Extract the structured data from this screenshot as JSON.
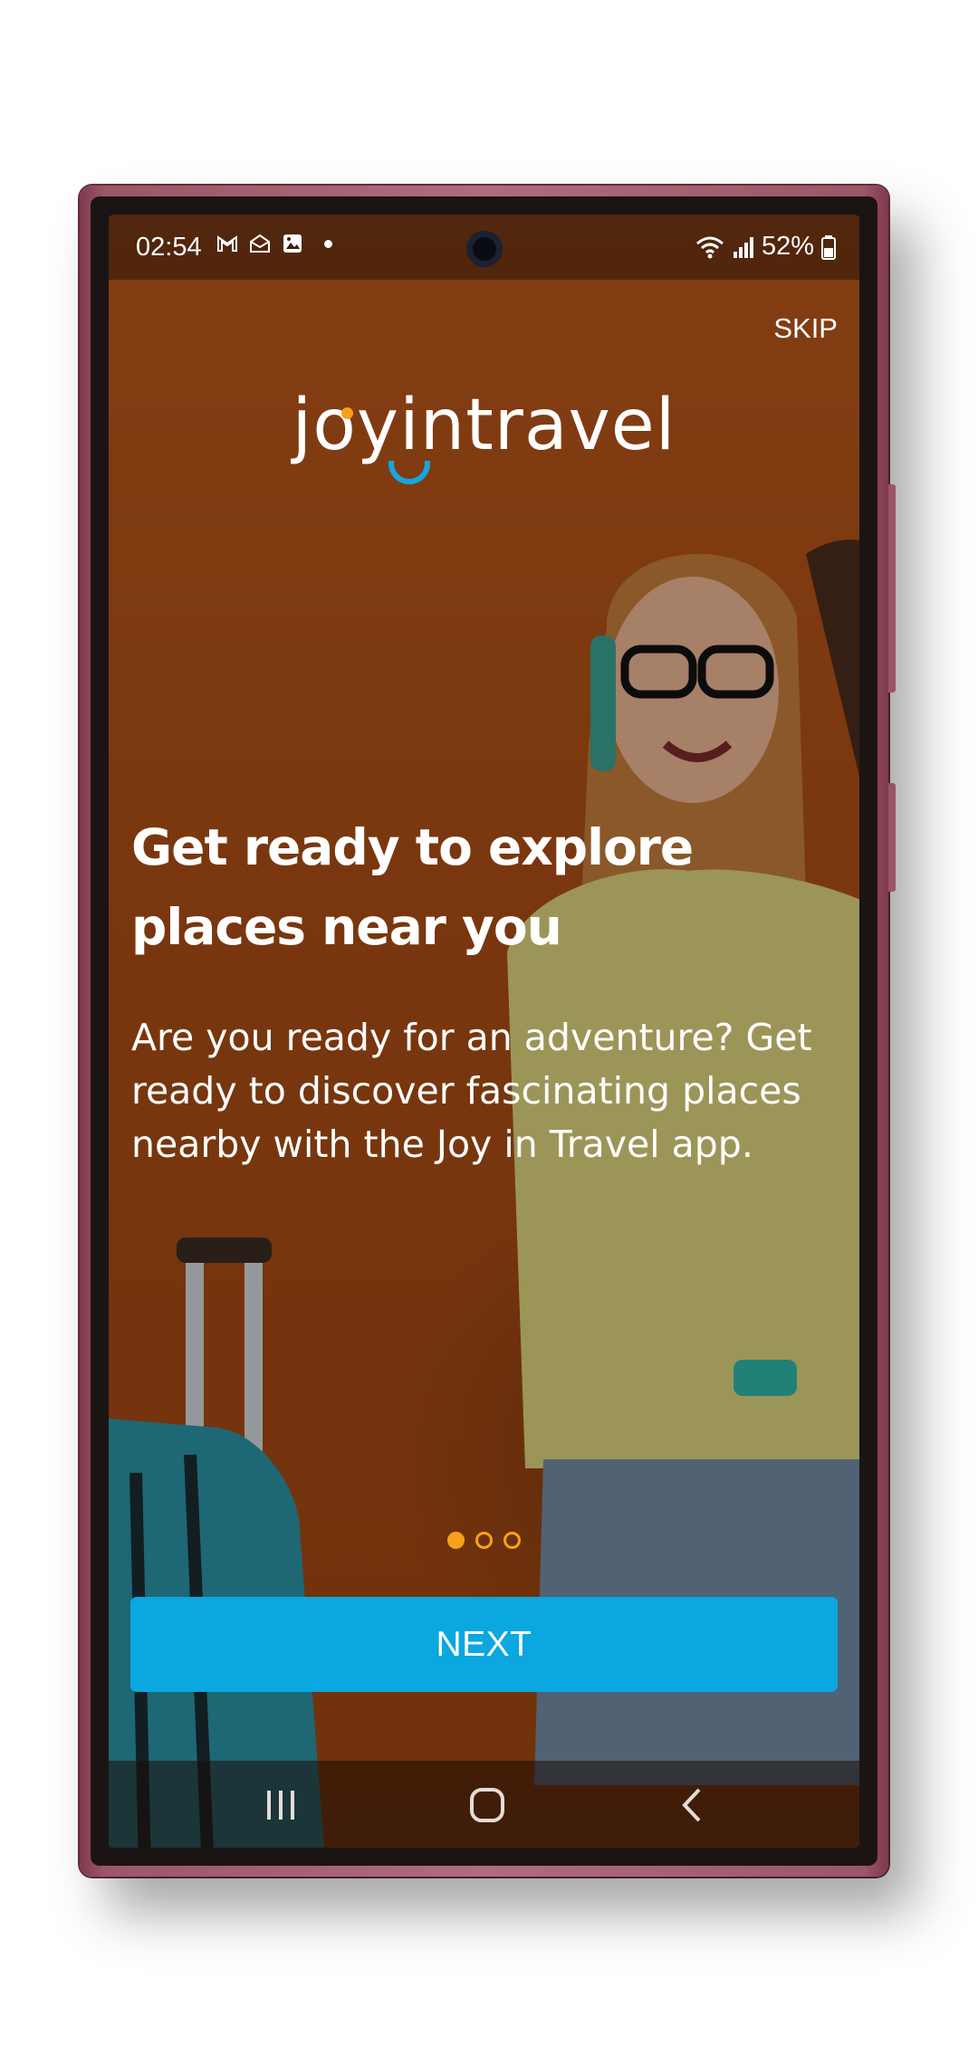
{
  "status_bar": {
    "time": "02:54",
    "battery": "52%",
    "icons": [
      "gmail-icon",
      "mail-open-icon",
      "gallery-icon",
      "notification-dot",
      "wifi-icon",
      "signal-icon",
      "battery-icon"
    ]
  },
  "header": {
    "skip_label": "SKIP",
    "logo_text": "joyintravel"
  },
  "onboarding": {
    "title_line1": "Get ready to explore",
    "title_line2": "places near you",
    "description": "Are you ready for an adventure? Get ready to discover fascinating places nearby with the Joy in Travel app.",
    "page_indicator": {
      "current": 1,
      "total": 3
    }
  },
  "actions": {
    "next_label": "NEXT"
  },
  "colors": {
    "accent_orange": "#f7a11a",
    "button_blue": "#0aa7e0",
    "background_orange": "#b0531a"
  }
}
